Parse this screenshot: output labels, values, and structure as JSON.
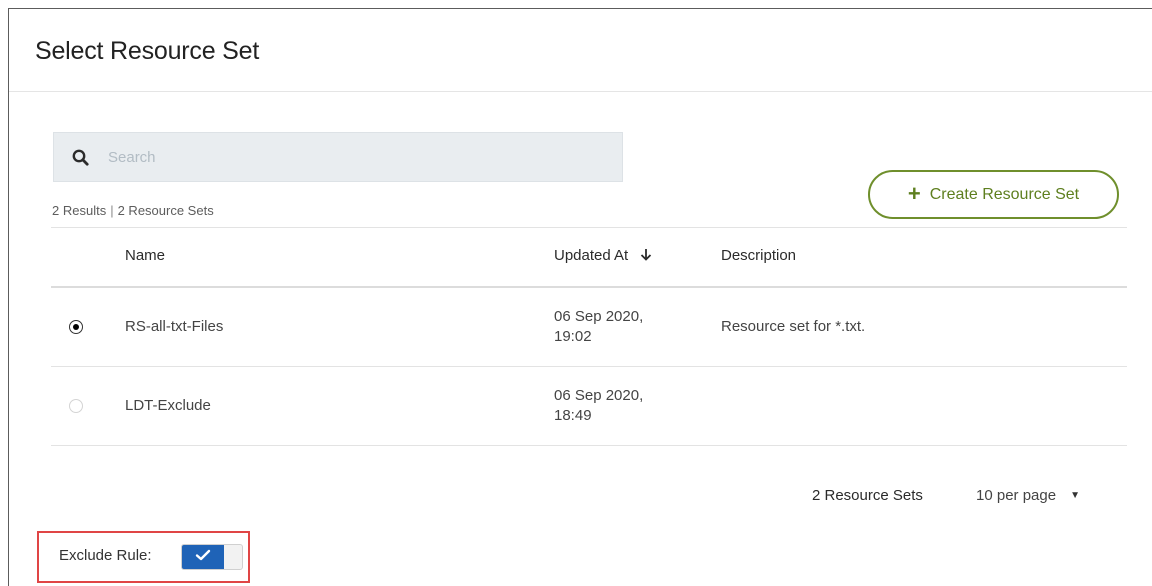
{
  "dialog": {
    "title": "Select Resource Set"
  },
  "search": {
    "placeholder": "Search",
    "value": "",
    "icon": "search-icon"
  },
  "results": {
    "count_label": "2 Results",
    "sets_label": "2 Resource Sets"
  },
  "create_button": {
    "label": "Create Resource Set",
    "icon": "plus-icon",
    "color": "#6f8f2c"
  },
  "table": {
    "columns": {
      "name": "Name",
      "updated_at": "Updated At",
      "description": "Description"
    },
    "sort": {
      "column": "updated_at",
      "direction": "descending",
      "icon": "arrow-down-icon"
    },
    "rows": [
      {
        "selected": true,
        "name": "RS-all-txt-Files",
        "updated_line1": "06 Sep 2020,",
        "updated_line2": "19:02",
        "description": "Resource set for *.txt."
      },
      {
        "selected": false,
        "name": "LDT-Exclude",
        "updated_line1": "06 Sep 2020,",
        "updated_line2": "18:49",
        "description": ""
      }
    ]
  },
  "pagination": {
    "total_label": "2 Resource Sets",
    "per_page_label": "10 per page"
  },
  "exclude_rule": {
    "label": "Exclude Rule:",
    "enabled": true,
    "toggle_color": "#1f63b7",
    "highlight_color": "#e04545"
  }
}
